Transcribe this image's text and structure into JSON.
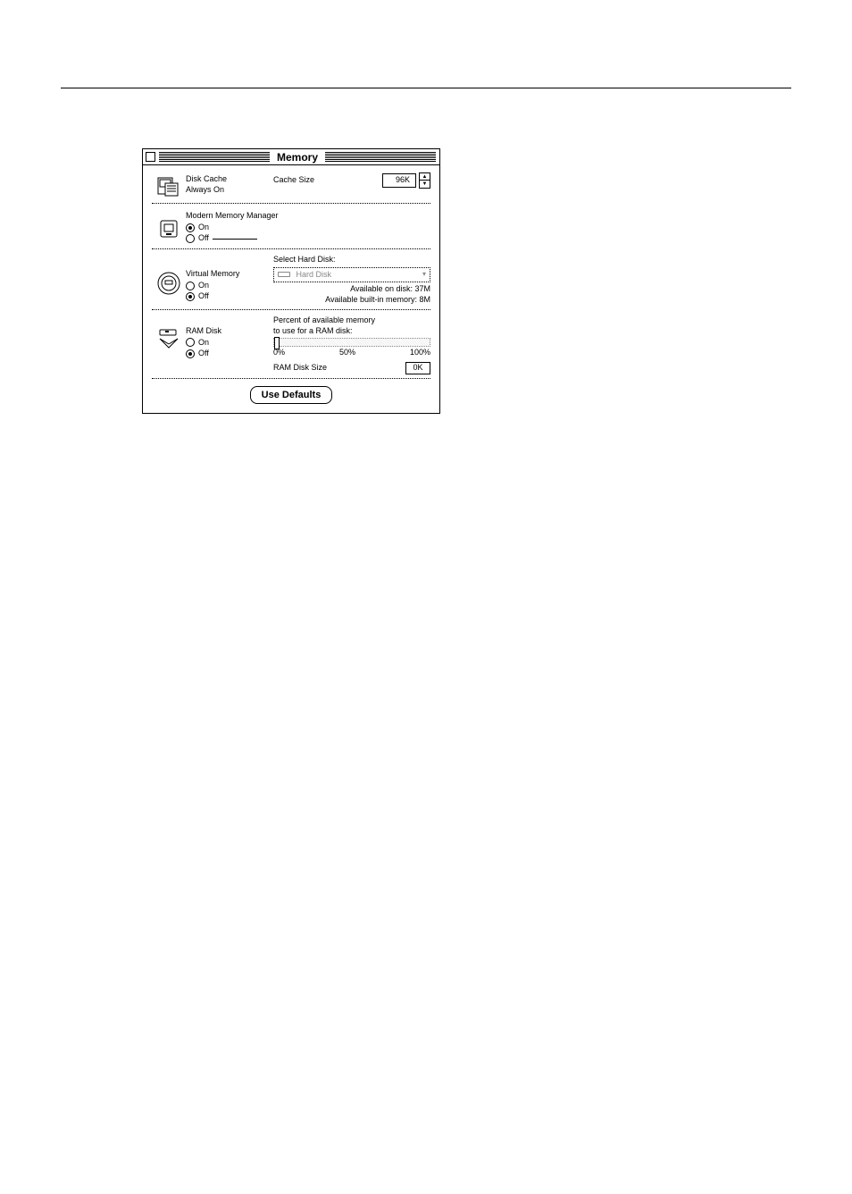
{
  "window": {
    "title": "Memory"
  },
  "disk_cache": {
    "label_line1": "Disk Cache",
    "label_line2": "Always On",
    "size_label": "Cache Size",
    "size_value": "96K"
  },
  "modern_memory": {
    "label": "Modern Memory Manager",
    "on_label": "On",
    "off_label": "Off",
    "selected": "on"
  },
  "virtual_memory": {
    "label": "Virtual Memory",
    "on_label": "On",
    "off_label": "Off",
    "selected": "off",
    "select_hd_label": "Select Hard Disk:",
    "hd_name": "Hard Disk",
    "available_disk": "Available on disk:  37M",
    "available_builtin": "Available built-in memory:  8M"
  },
  "ram_disk": {
    "label": "RAM Disk",
    "on_label": "On",
    "off_label": "Off",
    "selected": "off",
    "percent_line1": "Percent of available memory",
    "percent_line2": "to use for a RAM disk:",
    "scale_0": "0%",
    "scale_50": "50%",
    "scale_100": "100%",
    "size_label": "RAM Disk Size",
    "size_value": "0K"
  },
  "defaults_button": "Use Defaults"
}
